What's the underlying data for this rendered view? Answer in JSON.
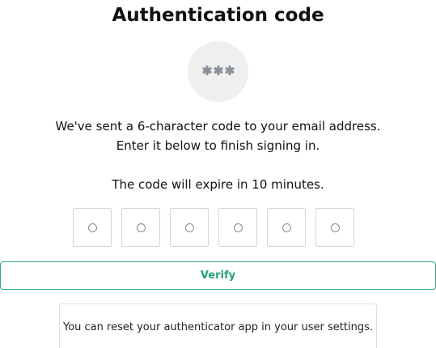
{
  "header": {
    "title": "Authentication code"
  },
  "badge": {
    "icon": "asterisk-password-icon",
    "icon_color": "#8a9199",
    "background": "#efefef"
  },
  "instructions": {
    "line1": "We've sent a 6-character code to your email address.",
    "line2": "Enter it below to finish signing in.",
    "expiry": "The code will expire in 10 minutes."
  },
  "code_input": {
    "length": 6,
    "placeholder_symbol": "circle-placeholder-icon"
  },
  "verify_button": {
    "label": "Verify",
    "color": "#22a276"
  },
  "notice": {
    "text": "You can reset your authenticator app in your user settings."
  }
}
